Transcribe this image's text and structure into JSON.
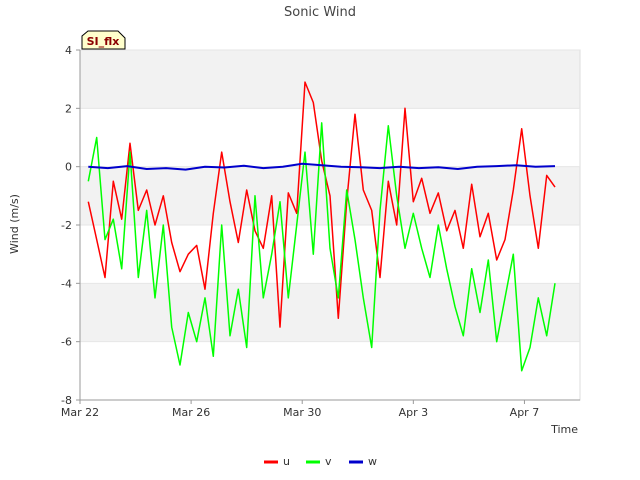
{
  "chart_data": {
    "type": "line",
    "title": "Sonic Wind",
    "xlabel": "Time",
    "ylabel": "Wind (m/s)",
    "badge": "SI_flx",
    "x_tick_labels": [
      "Mar 22",
      "Mar 26",
      "Mar 30",
      "Apr 3",
      "Apr 7"
    ],
    "x_tick_days": [
      0,
      4,
      8,
      12,
      16
    ],
    "xlim_days": [
      0,
      18
    ],
    "ylim": [
      -8,
      4
    ],
    "y_ticks": [
      -8,
      -6,
      -4,
      -2,
      0,
      2,
      4
    ],
    "grid": "horizontal bands",
    "legend_position": "bottom-center",
    "series": [
      {
        "name": "u",
        "color": "#ff0000",
        "x": [
          0.3,
          0.6,
          0.9,
          1.2,
          1.5,
          1.8,
          2.1,
          2.4,
          2.7,
          3.0,
          3.3,
          3.6,
          3.9,
          4.2,
          4.5,
          4.8,
          5.1,
          5.4,
          5.7,
          6.0,
          6.3,
          6.6,
          6.9,
          7.2,
          7.5,
          7.8,
          8.1,
          8.4,
          8.7,
          9.0,
          9.3,
          9.6,
          9.9,
          10.2,
          10.5,
          10.8,
          11.1,
          11.4,
          11.7,
          12.0,
          12.3,
          12.6,
          12.9,
          13.2,
          13.5,
          13.8,
          14.1,
          14.4,
          14.7,
          15.0,
          15.3,
          15.6,
          15.9,
          16.2,
          16.5,
          16.8,
          17.1
        ],
        "values": [
          -1.2,
          -2.5,
          -3.8,
          -0.5,
          -1.8,
          0.8,
          -1.5,
          -0.8,
          -2.0,
          -1.0,
          -2.6,
          -3.6,
          -3.0,
          -2.7,
          -4.2,
          -1.6,
          0.5,
          -1.2,
          -2.6,
          -0.8,
          -2.2,
          -2.8,
          -1.0,
          -5.5,
          -0.9,
          -1.6,
          2.9,
          2.2,
          0.2,
          -1.0,
          -5.2,
          -1.2,
          1.8,
          -0.8,
          -1.5,
          -3.8,
          -0.5,
          -2.0,
          2.0,
          -1.2,
          -0.4,
          -1.6,
          -0.9,
          -2.2,
          -1.5,
          -2.8,
          -0.6,
          -2.4,
          -1.6,
          -3.2,
          -2.5,
          -0.8,
          1.3,
          -1.0,
          -2.8,
          -0.3,
          -0.7
        ],
        "line_width": 1.5
      },
      {
        "name": "v",
        "color": "#00ff00",
        "x": [
          0.3,
          0.6,
          0.9,
          1.2,
          1.5,
          1.8,
          2.1,
          2.4,
          2.7,
          3.0,
          3.3,
          3.6,
          3.9,
          4.2,
          4.5,
          4.8,
          5.1,
          5.4,
          5.7,
          6.0,
          6.3,
          6.6,
          6.9,
          7.2,
          7.5,
          7.8,
          8.1,
          8.4,
          8.7,
          9.0,
          9.3,
          9.6,
          9.9,
          10.2,
          10.5,
          10.8,
          11.1,
          11.4,
          11.7,
          12.0,
          12.3,
          12.6,
          12.9,
          13.2,
          13.5,
          13.8,
          14.1,
          14.4,
          14.7,
          15.0,
          15.3,
          15.6,
          15.9,
          16.2,
          16.5,
          16.8,
          17.1
        ],
        "values": [
          -0.5,
          1.0,
          -2.5,
          -1.8,
          -3.5,
          0.5,
          -3.8,
          -1.5,
          -4.5,
          -2.0,
          -5.5,
          -6.8,
          -5.0,
          -6.0,
          -4.5,
          -6.5,
          -2.0,
          -5.8,
          -4.2,
          -6.2,
          -1.0,
          -4.5,
          -3.0,
          -1.2,
          -4.5,
          -2.0,
          0.5,
          -3.0,
          1.5,
          -2.8,
          -4.5,
          -0.8,
          -2.5,
          -4.5,
          -6.2,
          -1.5,
          1.4,
          -1.0,
          -2.8,
          -1.6,
          -2.8,
          -3.8,
          -2.0,
          -3.5,
          -4.8,
          -5.8,
          -3.5,
          -5.0,
          -3.2,
          -6.0,
          -4.5,
          -3.0,
          -7.0,
          -6.2,
          -4.5,
          -5.8,
          -4.0
        ],
        "line_width": 1.5
      },
      {
        "name": "w",
        "color": "#0000cc",
        "x": [
          0.3,
          1.0,
          1.7,
          2.4,
          3.1,
          3.8,
          4.5,
          5.2,
          5.9,
          6.6,
          7.3,
          8.0,
          8.7,
          9.4,
          10.1,
          10.8,
          11.5,
          12.2,
          12.9,
          13.6,
          14.3,
          15.0,
          15.7,
          16.4,
          17.1
        ],
        "values": [
          0.0,
          -0.05,
          0.02,
          -0.08,
          -0.05,
          -0.1,
          0.0,
          -0.03,
          0.03,
          -0.05,
          0.0,
          0.1,
          0.05,
          0.0,
          -0.02,
          -0.05,
          0.0,
          -0.05,
          -0.02,
          -0.08,
          0.0,
          0.02,
          0.05,
          0.0,
          0.02
        ],
        "line_width": 2
      }
    ]
  }
}
